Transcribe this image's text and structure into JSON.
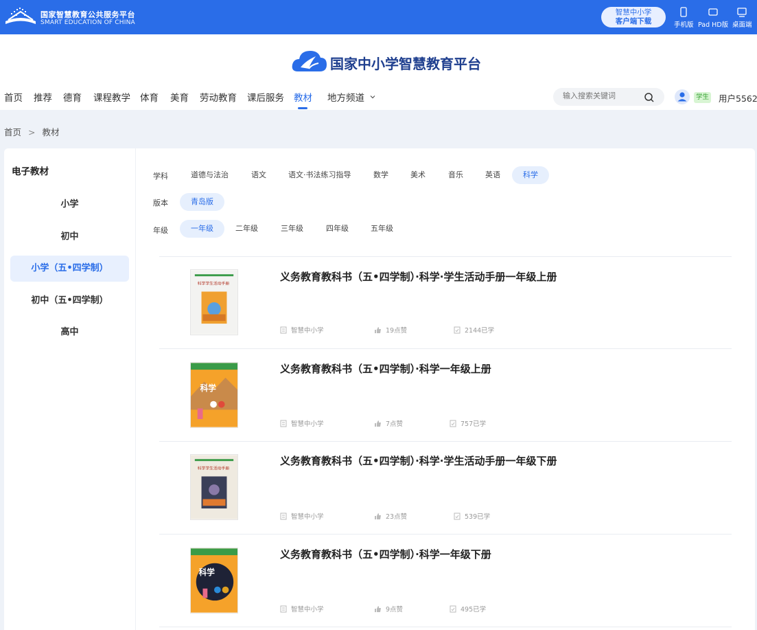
{
  "topbar": {
    "title": "国家智慧教育公共服务平台",
    "subtitle": "SMART EDUCATION OF CHINA",
    "download_line1": "智慧中小学",
    "download_line2": "客户端下载",
    "devices": [
      {
        "label": "手机版",
        "icon": "phone-icon"
      },
      {
        "label": "Pad HD版",
        "icon": "tablet-icon"
      },
      {
        "label": "桌面端",
        "icon": "desktop-icon"
      }
    ]
  },
  "brand": {
    "name": "国家中小学智慧教育平台"
  },
  "nav": {
    "items": [
      "首页",
      "推荐",
      "德育",
      "课程教学",
      "体育",
      "美育",
      "劳动教育",
      "课后服务",
      "教材",
      "地方频道"
    ],
    "active": "教材"
  },
  "search": {
    "placeholder": "输入搜索关键词"
  },
  "user": {
    "badge": "学生",
    "name": "用户5562"
  },
  "breadcrumb": {
    "home": "首页",
    "sep": ">",
    "current": "教材"
  },
  "sidebar": {
    "title": "电子教材",
    "items": [
      "小学",
      "初中",
      "小学（五•四学制）",
      "初中（五•四学制）",
      "高中"
    ],
    "active": "小学（五•四学制）"
  },
  "filters": {
    "subject_label": "学科",
    "subjects": [
      "道德与法治",
      "语文",
      "语文·书法练习指导",
      "数学",
      "美术",
      "音乐",
      "英语",
      "科学"
    ],
    "subject_active": "科学",
    "edition_label": "版本",
    "editions": [
      "青岛版"
    ],
    "edition_active": "青岛版",
    "grade_label": "年级",
    "grades": [
      "一年级",
      "二年级",
      "三年级",
      "四年级",
      "五年级"
    ],
    "grade_active": "一年级"
  },
  "books": [
    {
      "title": "义务教育教科书（五•四学制）·科学·学生活动手册一年级上册",
      "publisher": "智慧中小学",
      "likes": "19点赞",
      "learned": "2144已学",
      "cover_color": "#f3f3f1",
      "cover_text": "科学学生活动手册"
    },
    {
      "title": "义务教育教科书（五•四学制）·科学一年级上册",
      "publisher": "智慧中小学",
      "likes": "7点赞",
      "learned": "757已学",
      "cover_color": "#f5a22a",
      "cover_text": "科学"
    },
    {
      "title": "义务教育教科书（五•四学制）·科学·学生活动手册一年级下册",
      "publisher": "智慧中小学",
      "likes": "23点赞",
      "learned": "539已学",
      "cover_color": "#efeae0",
      "cover_text": "科学学生活动手册"
    },
    {
      "title": "义务教育教科书（五•四学制）·科学一年级下册",
      "publisher": "智慧中小学",
      "likes": "9点赞",
      "learned": "495已学",
      "cover_color": "#f5a22a",
      "cover_text": "科学"
    }
  ],
  "colors": {
    "primary": "#2a6de8",
    "brand_text": "#1f3f8f",
    "chip_bg": "#e6effd"
  }
}
